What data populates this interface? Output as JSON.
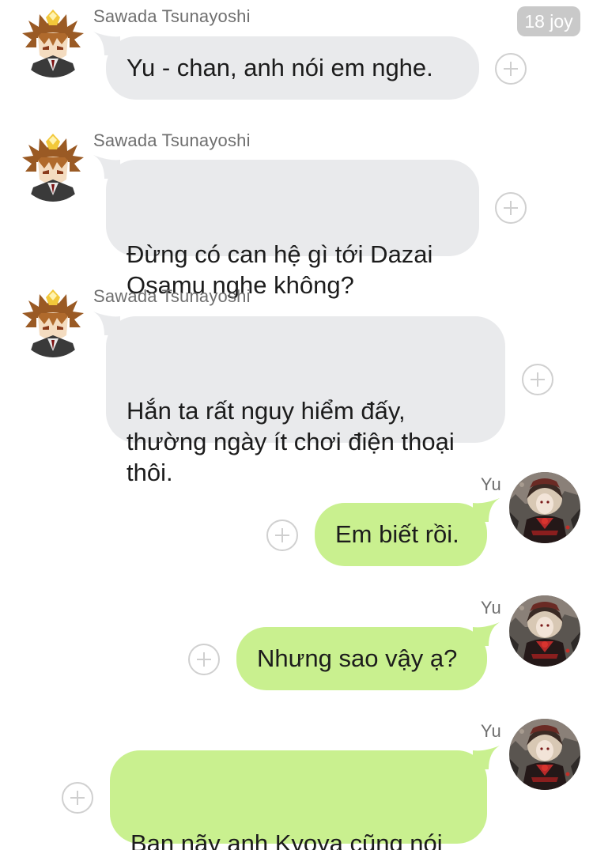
{
  "badge": {
    "text": "18 joy"
  },
  "messages": [
    {
      "sender": "Sawada Tsunayoshi",
      "text": "Yu - chan, anh nói em nghe.",
      "direction": "incoming"
    },
    {
      "sender": "Sawada Tsunayoshi",
      "text": "Đừng có can hệ gì tới Dazai\nOsamu nghe không?",
      "direction": "incoming"
    },
    {
      "sender": "Sawada Tsunayoshi",
      "text": "Hắn ta rất nguy hiểm đấy,\nthường ngày ít chơi điện thoại\nthôi.",
      "direction": "incoming"
    },
    {
      "sender": "Yu",
      "text": "Em biết rồi.",
      "direction": "outgoing"
    },
    {
      "sender": "Yu",
      "text": "Nhưng sao vậy ạ?",
      "direction": "outgoing"
    },
    {
      "sender": "Yu",
      "text": "Ban nãy anh Kyoya cũng nói\nem vậy.",
      "direction": "outgoing"
    }
  ],
  "icons": {
    "add": "plus-circle-icon",
    "incoming_avatar": "spiky-hair-character-avatar",
    "outgoing_avatar": "gothic-doll-avatar"
  },
  "colors": {
    "incoming_bubble": "#e9eaec",
    "outgoing_bubble": "#c9f08f",
    "badge": "#c9c9c9",
    "sender_text": "#6f6f6f"
  }
}
